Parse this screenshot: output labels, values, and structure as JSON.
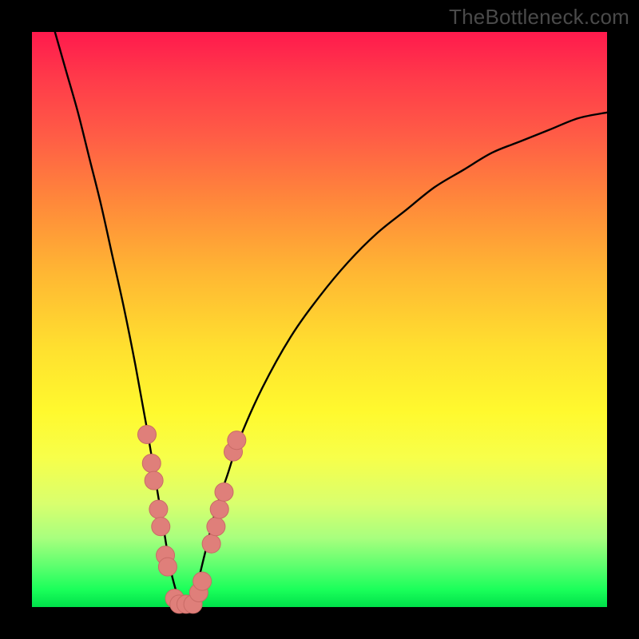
{
  "watermark": "TheBottleneck.com",
  "colors": {
    "background_frame": "#000000",
    "gradient_top": "#ff1a4d",
    "gradient_bottom": "#00e04a",
    "curve": "#000000",
    "markers_fill": "#df7f7a",
    "markers_stroke": "#c96b66"
  },
  "chart_data": {
    "type": "line",
    "title": "",
    "xlabel": "",
    "ylabel": "",
    "xlim": [
      0,
      100
    ],
    "ylim": [
      0,
      100
    ],
    "legend": null,
    "grid": false,
    "series": [
      {
        "name": "bottleneck-curve",
        "comment": "Estimated V-shaped bottleneck curve; y = percentage distance from optimum (0 at valley ~x≈26, 100 at top). Values read from vertical position relative to plot height.",
        "x": [
          4,
          6,
          8,
          10,
          12,
          14,
          16,
          18,
          20,
          22,
          23,
          24,
          25,
          26,
          27,
          28,
          29,
          30,
          32,
          34,
          36,
          40,
          45,
          50,
          55,
          60,
          65,
          70,
          75,
          80,
          85,
          90,
          95,
          100
        ],
        "y": [
          100,
          93,
          86,
          78,
          70,
          61,
          52,
          42,
          31,
          19,
          13,
          7,
          3,
          0,
          0,
          2,
          5,
          9,
          17,
          23,
          29,
          38,
          47,
          54,
          60,
          65,
          69,
          73,
          76,
          79,
          81,
          83,
          85,
          86
        ]
      }
    ],
    "markers": {
      "comment": "Salmon-colored circular markers clustered near the valley; coordinates estimated in same 0–100 space as the curve.",
      "points": [
        {
          "x": 20.0,
          "y": 30
        },
        {
          "x": 20.8,
          "y": 25
        },
        {
          "x": 21.2,
          "y": 22
        },
        {
          "x": 22.0,
          "y": 17
        },
        {
          "x": 22.4,
          "y": 14
        },
        {
          "x": 23.2,
          "y": 9
        },
        {
          "x": 23.6,
          "y": 7
        },
        {
          "x": 24.8,
          "y": 1.5
        },
        {
          "x": 25.6,
          "y": 0.5
        },
        {
          "x": 26.8,
          "y": 0.5
        },
        {
          "x": 28.0,
          "y": 0.5
        },
        {
          "x": 29.0,
          "y": 2.5
        },
        {
          "x": 29.6,
          "y": 4.5
        },
        {
          "x": 31.2,
          "y": 11
        },
        {
          "x": 32.0,
          "y": 14
        },
        {
          "x": 32.6,
          "y": 17
        },
        {
          "x": 33.4,
          "y": 20
        },
        {
          "x": 35.0,
          "y": 27
        },
        {
          "x": 35.6,
          "y": 29
        }
      ],
      "radius_pct": 1.6
    }
  }
}
